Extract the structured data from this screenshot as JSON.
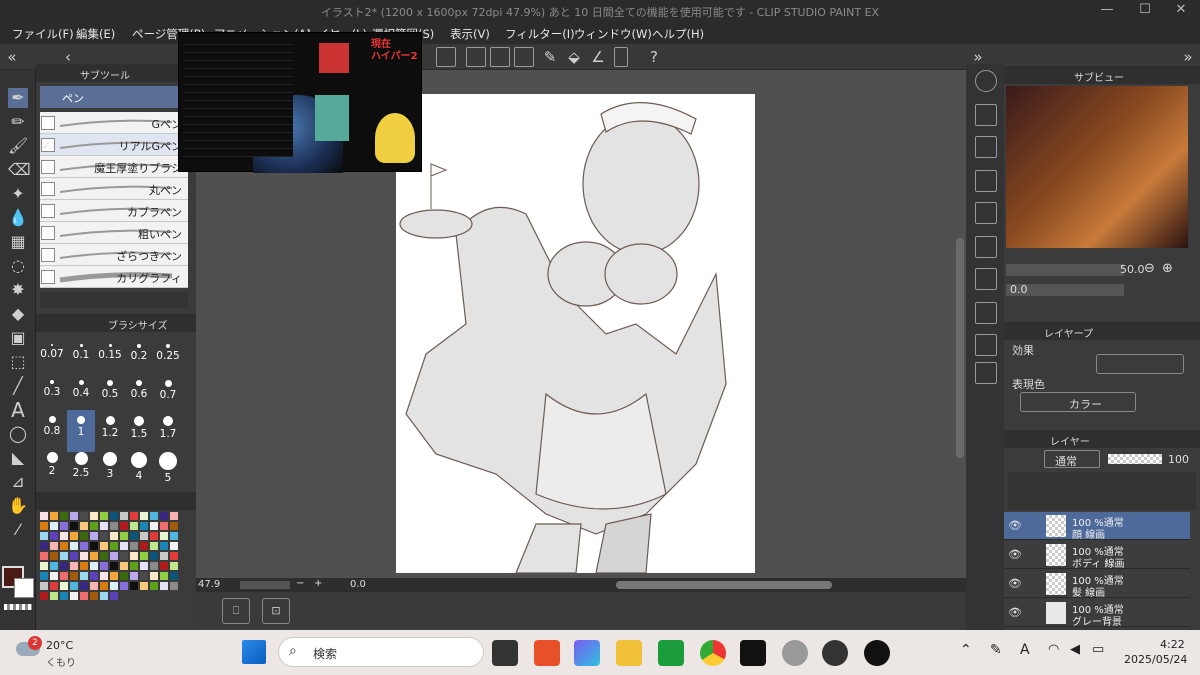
{
  "window": {
    "title": "イラスト2* (1200 x 1600px 72dpi 47.9%) あと 10 日間全ての機能を使用可能です - CLIP STUDIO PAINT EX",
    "min": "—",
    "max": "☐",
    "close": "✕"
  },
  "menu": [
    "ファイル(F)",
    "編集(E)",
    "ページ管理(P)",
    "アニメーション(A)",
    "レイヤー(L)",
    "選択範囲(S)",
    "表示(V)",
    "フィルター(I)",
    "ウィンドウ(W)",
    "ヘルプ(H)"
  ],
  "subtool": {
    "tab": "サブツール",
    "title": "ペン",
    "brushes": [
      "Gペン",
      "リアルGペン",
      "魔王厚塗りブラシ",
      "丸ペン",
      "カブラペン",
      "粗いペン",
      "ざらつきペン",
      "カリグラフィ"
    ],
    "size_tab": "ブラシサイズ",
    "sizes": [
      "0.07",
      "0.1",
      "0.15",
      "0.2",
      "0.25",
      "0.3",
      "0.4",
      "0.5",
      "0.6",
      "0.7",
      "0.8",
      "1",
      "1.2",
      "1.5",
      "1.7",
      "2",
      "2.5",
      "3",
      "4",
      "5"
    ],
    "selected_size": "1"
  },
  "status": {
    "zoom": "47.9",
    "angle": "0.0"
  },
  "navigator": {
    "tab": "サブビュー",
    "zoom": "50.0",
    "angle": "0.0"
  },
  "layer_property": {
    "tab": "レイヤープ",
    "effect_label": "効果",
    "expr_label": "表現色",
    "color_mode": "カラー"
  },
  "layers": {
    "tab": "レイヤー",
    "blend": "通常",
    "opacity": "100",
    "items": [
      {
        "opacity": "100 %通常",
        "name": "顔 線画",
        "selected": true
      },
      {
        "opacity": "100 %通常",
        "name": "ボディ 線画",
        "selected": false
      },
      {
        "opacity": "100 %通常",
        "name": "髪 線画",
        "selected": false
      },
      {
        "opacity": "100 %通常",
        "name": "グレー背景",
        "selected": false
      }
    ]
  },
  "overlay": {
    "title": "現在\nハイパー2"
  },
  "taskbar": {
    "weather_badge": "2",
    "temp": "20°C",
    "weather": "くもり",
    "search": "検索",
    "time": "4:22",
    "date": "2025/05/24",
    "ime": "A"
  },
  "colors": {
    "main": "#4a1a14",
    "sub": "#ffffff",
    "selection": "#4d6a9a"
  }
}
